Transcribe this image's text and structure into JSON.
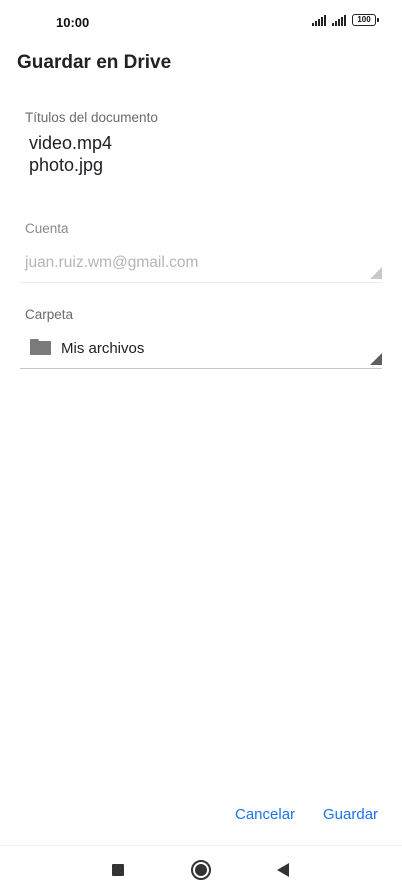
{
  "status_bar": {
    "time": "10:00",
    "battery": "100"
  },
  "page": {
    "title": "Guardar en Drive"
  },
  "document_titles": {
    "label": "Títulos del documento",
    "items": [
      "video.mp4",
      "photo.jpg"
    ]
  },
  "account": {
    "label": "Cuenta",
    "value": "juan.ruiz.wm@gmail.com"
  },
  "folder": {
    "label": "Carpeta",
    "value": "Mis archivos",
    "icon": "folder-icon"
  },
  "actions": {
    "cancel_label": "Cancelar",
    "save_label": "Guardar"
  },
  "colors": {
    "accent": "#1a73e8",
    "text": "#202124",
    "muted": "#b5b5b5"
  }
}
